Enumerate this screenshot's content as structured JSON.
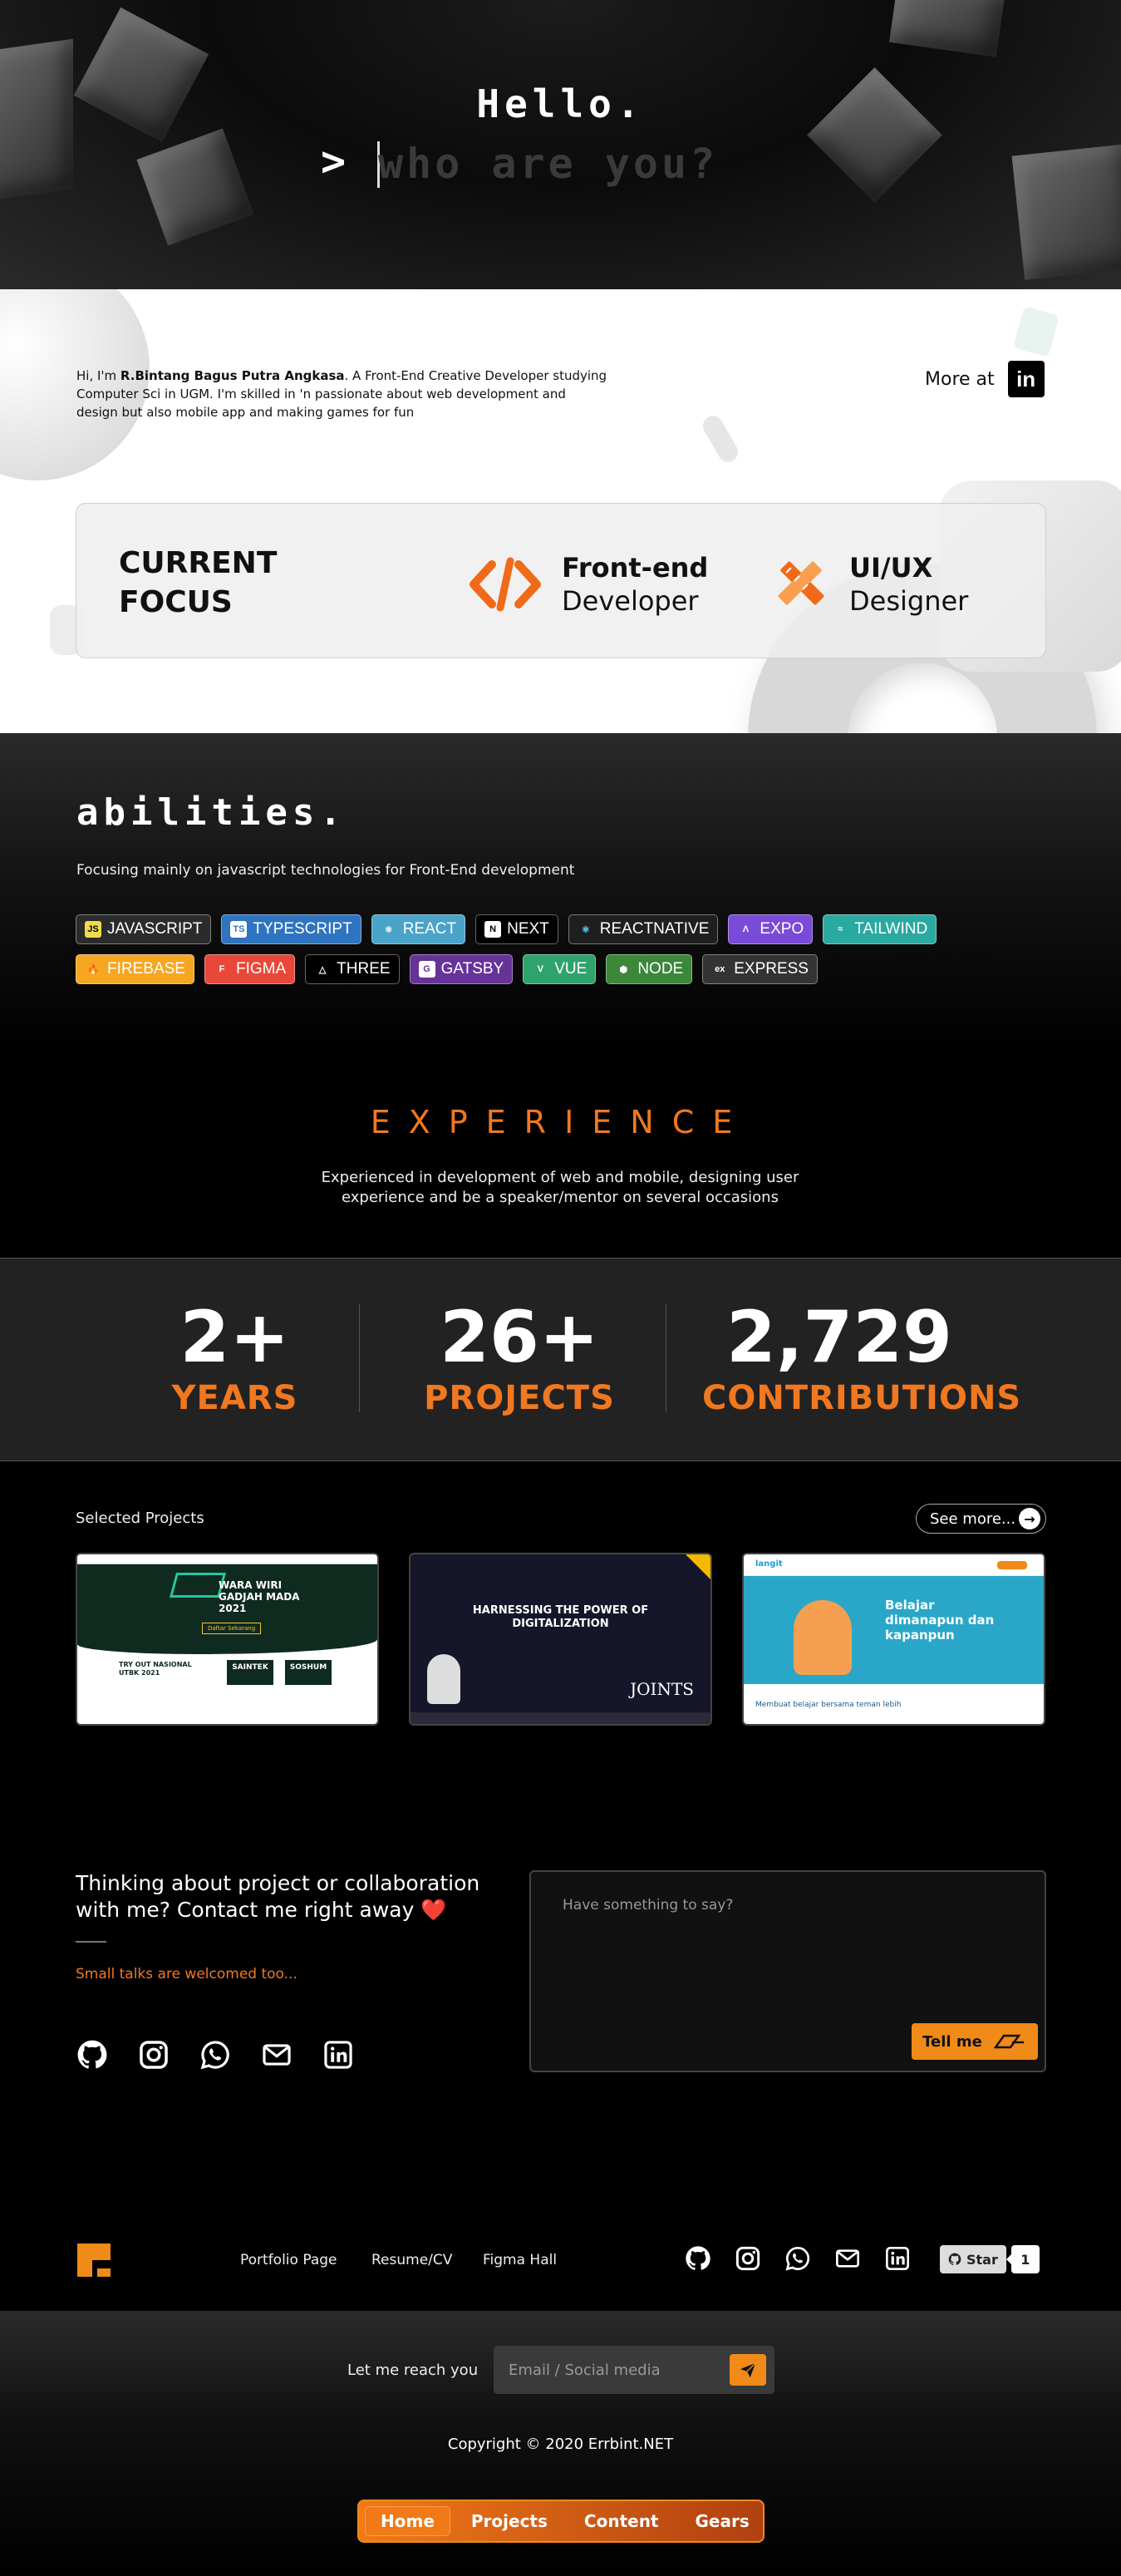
{
  "hero": {
    "greeting": "Hello.",
    "prompt_symbol": ">",
    "input_placeholder": "who are you?"
  },
  "about": {
    "intro_pre": "Hi, I'm ",
    "intro_name": "R.Bintang Bagus Putra Angkasa",
    "intro_post": ". A Front-End Creative Developer studying Computer Sci in UGM. I'm skilled in 'n passionate about web development and design but also mobile app and making games for fun",
    "more_label": "More at",
    "linkedin_icon": "in"
  },
  "focus": {
    "title_line1": "CURRENT",
    "title_line2": "FOCUS",
    "items": [
      {
        "line1": "Front-end",
        "line2": "Developer",
        "icon": "code-icon"
      },
      {
        "line1": "UI/UX",
        "line2": "Designer",
        "icon": "design-tools-icon"
      }
    ]
  },
  "abilities": {
    "title": "abilities.",
    "subtitle": "Focusing mainly on javascript technologies for Front-End development",
    "badges": [
      {
        "label": "JAVASCRIPT",
        "icon": "JS",
        "bg": "#2b2b2b",
        "iconBg": "#f0db4f",
        "iconColor": "#000"
      },
      {
        "label": "TYPESCRIPT",
        "icon": "TS",
        "bg": "#2f74c0",
        "iconBg": "#fff",
        "iconColor": "#2f74c0"
      },
      {
        "label": "REACT",
        "icon": "⚛",
        "bg": "#4aa3c8",
        "iconBg": "transparent",
        "iconColor": "#fff"
      },
      {
        "label": "NEXT",
        "icon": "N",
        "bg": "#000",
        "iconBg": "#fff",
        "iconColor": "#000"
      },
      {
        "label": "REACTNATIVE",
        "icon": "⚛",
        "bg": "#1f1f1f",
        "iconBg": "transparent",
        "iconColor": "#61dafb"
      },
      {
        "label": "EXPO",
        "icon": "Λ",
        "bg": "#7a4ad8",
        "iconBg": "transparent",
        "iconColor": "#fff"
      },
      {
        "label": "TAILWIND",
        "icon": "≈",
        "bg": "#2aa9a0",
        "iconBg": "transparent",
        "iconColor": "#fff"
      },
      {
        "label": "FIREBASE",
        "icon": "🔥",
        "bg": "#f5a623",
        "iconBg": "transparent",
        "iconColor": "#fff"
      },
      {
        "label": "FIGMA",
        "icon": "F",
        "bg": "#e8483a",
        "iconBg": "transparent",
        "iconColor": "#fff"
      },
      {
        "label": "THREE",
        "icon": "△",
        "bg": "#000",
        "iconBg": "transparent",
        "iconColor": "#fff"
      },
      {
        "label": "GATSBY",
        "icon": "G",
        "bg": "#663399",
        "iconBg": "#fff",
        "iconColor": "#663399"
      },
      {
        "label": "VUE",
        "icon": "V",
        "bg": "#2fa36c",
        "iconBg": "transparent",
        "iconColor": "#fff"
      },
      {
        "label": "NODE",
        "icon": "⬢",
        "bg": "#3c873a",
        "iconBg": "transparent",
        "iconColor": "#fff"
      },
      {
        "label": "EXPRESS",
        "icon": "ex",
        "bg": "#333",
        "iconBg": "transparent",
        "iconColor": "#fff"
      }
    ]
  },
  "experience": {
    "title": "EXPERIENCE",
    "subtitle": "Experienced in development of web and mobile, designing user experience and be a speaker/mentor on several occasions",
    "stats": [
      {
        "value": "2+",
        "label": "YEARS"
      },
      {
        "value": "26+",
        "label": "PROJECTS"
      },
      {
        "value": "2,729",
        "label": "CONTRIBUTIONS"
      }
    ]
  },
  "projects": {
    "heading": "Selected Projects",
    "see_more": "See more...",
    "cards": [
      {
        "name": "WARA WIRI GADJAH MADA 2021",
        "sub1": "TRY OUT NASIONAL UTBK 2021",
        "tag1": "SAINTEK",
        "tag2": "SOSHUM",
        "btn": "Daftar Sekarang"
      },
      {
        "name": "HARNESSING THE POWER OF DIGITALIZATION",
        "highlight": "POWER",
        "brand": "JOINTS"
      },
      {
        "name": "Belajar dimanapun dan kapanpun",
        "brand": "langit",
        "foot": "Membuat belajar bersama teman lebih"
      }
    ]
  },
  "contact": {
    "title": "Thinking about project or collaboration with me? Contact me right away ❤️",
    "small": "Small talks are welcomed too...",
    "message_placeholder": "Have something to say?",
    "send_label": "Tell me",
    "socials": [
      "github-icon",
      "instagram-icon",
      "whatsapp-icon",
      "mail-icon",
      "linkedin-icon"
    ]
  },
  "footer": {
    "nav": [
      "Portfolio Page",
      "Resume/CV",
      "Figma Hall"
    ],
    "star_label": "Star",
    "star_count": "1",
    "reach_label": "Let me reach you",
    "reach_placeholder": "Email / Social media",
    "copyright": "Copyright © 2020 Errbint.NET",
    "bottom_nav": [
      "Home",
      "Projects",
      "Content",
      "Gears"
    ],
    "accent": "#f07820"
  }
}
